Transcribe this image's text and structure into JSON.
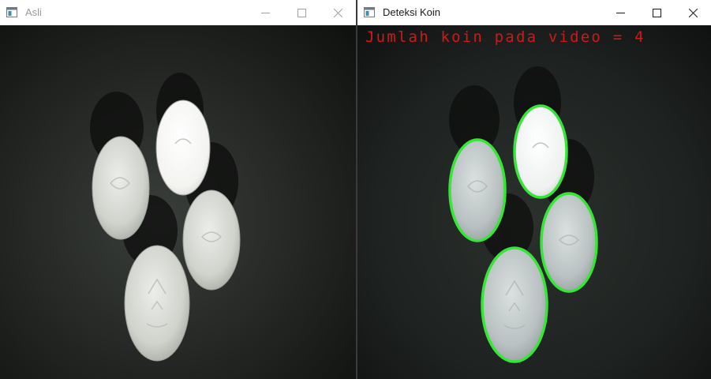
{
  "windows": [
    {
      "title": "Asli",
      "controls": {
        "minimize": "minimize-icon",
        "maximize": "maximize-icon",
        "close": "close-icon"
      }
    },
    {
      "title": "Deteksi Koin",
      "overlay_text": "Jumlah koin pada video = 4",
      "controls": {
        "minimize": "minimize-icon",
        "maximize": "maximize-icon",
        "close": "close-icon"
      }
    }
  ],
  "detection": {
    "coin_count": 4,
    "outline_color": "#36e636",
    "text_color": "#d01818"
  },
  "colors": {
    "table": "#252825",
    "coin": "#d8dcd6",
    "coin_bright": "#f7f7f4"
  }
}
